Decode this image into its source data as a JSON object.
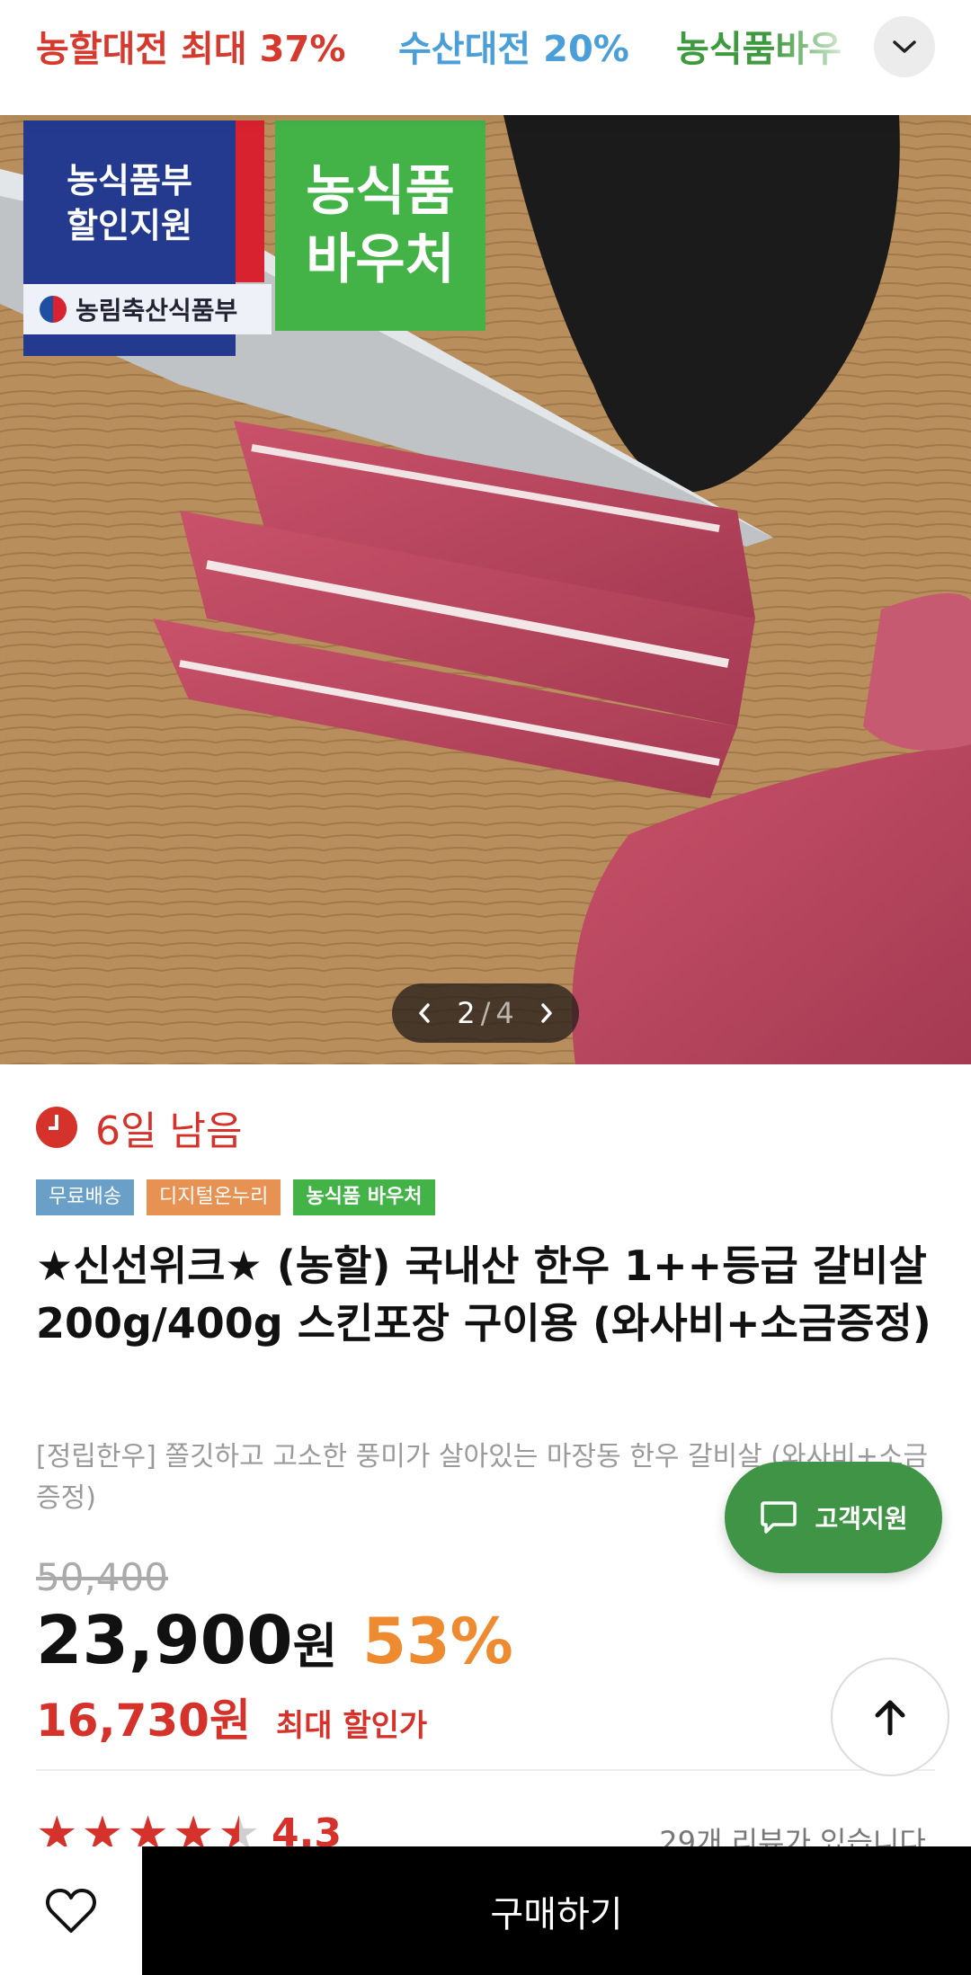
{
  "top_tabs": [
    {
      "label": "농할대전 최대 37%",
      "color": "#d63a2e"
    },
    {
      "label": "수산대전 20%",
      "color": "#4a9fd8"
    },
    {
      "label": "농식품바우",
      "color": "#3f9a3f"
    }
  ],
  "hero": {
    "badge_left_line1": "농식품부",
    "badge_left_line2": "할인지원",
    "ministry_label": "농림축산식품부",
    "badge_right_line1": "농식품",
    "badge_right_line2": "바우처",
    "pager_current": "2",
    "pager_separator": "/",
    "pager_total": "4"
  },
  "product": {
    "remaining": "6일 남음",
    "tags": [
      {
        "label": "무료배송"
      },
      {
        "label": "디지털온누리"
      },
      {
        "label": "농식품 바우처"
      }
    ],
    "title": "★신선위크★ (농할) 국내산 한우 1++등급 갈비살 200g/400g 스킨포장 구이용 (와사비+소금증정)",
    "subtitle": "[정립한우] 쫄깃하고 고소한 풍미가 살아있는 마장동 한우 갈비살 (와사비+소금증정)",
    "original_price": "50,400",
    "price": "23,900",
    "price_unit": "원",
    "discount_rate": "53%",
    "max_discount_price": "16,730원",
    "max_discount_label": "최대 할인가",
    "rating": "4.3",
    "rating_value": 4.3,
    "review_count": "29개 리뷰가 있습니다."
  },
  "support_button": {
    "label": "고객지원"
  },
  "bottom_bar": {
    "buy_label": "구매하기"
  },
  "colors": {
    "accent_red": "#d4322a",
    "accent_orange": "#ee8a2f",
    "support_green": "#3f9445",
    "voucher_green": "#43b348"
  }
}
